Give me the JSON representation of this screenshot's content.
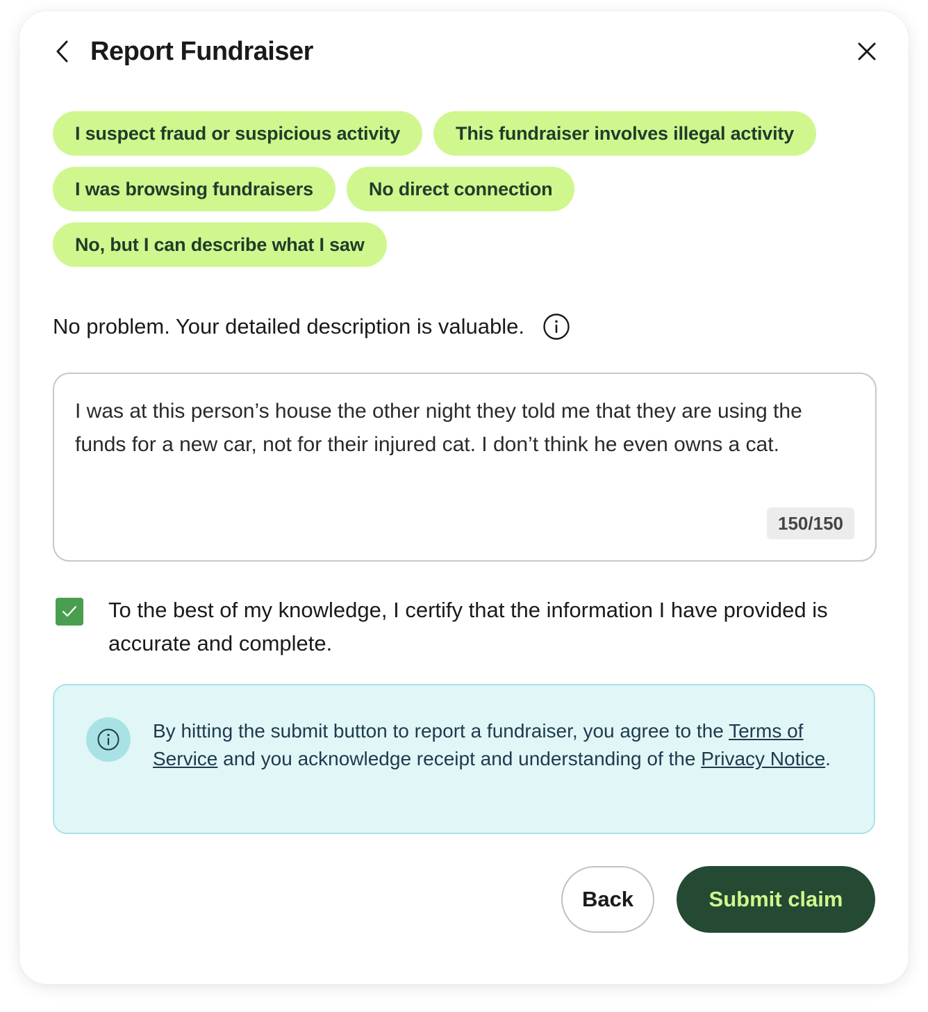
{
  "header": {
    "title": "Report Fundraiser",
    "back_icon": "chevron-left-icon",
    "close_icon": "close-icon"
  },
  "chips": [
    [
      "I suspect fraud or suspicious activity",
      "This fundraiser involves illegal activity"
    ],
    [
      "I was browsing fundraisers",
      "No direct connection"
    ],
    [
      "No, but I can describe what I saw"
    ]
  ],
  "prompt": {
    "text": "No problem. Your detailed description is valuable.",
    "icon": "info-icon"
  },
  "description": {
    "value": "I was at this person’s house the other night they told me that they are using the funds for a new car,  not for their injured cat. I don’t think he even owns a cat.",
    "counter": "150/150"
  },
  "certify": {
    "checked": true,
    "text": "To the best of my knowledge, I certify that the information I have provided is accurate and complete."
  },
  "notice": {
    "text_before": "By hitting the submit button to report a fundraiser, you agree to the ",
    "terms_link": "Terms of Service",
    "text_middle": " and you acknowledge receipt and understanding of the ",
    "privacy_link": "Privacy Notice",
    "text_after": ".",
    "icon": "info-icon"
  },
  "actions": {
    "back_label": "Back",
    "submit_label": "Submit claim"
  },
  "colors": {
    "chip_bg": "#cff78e",
    "chip_text": "#1f3d2a",
    "submit_bg": "#244a33",
    "submit_text": "#cff78e",
    "checkbox": "#4a9e4f",
    "notice_bg": "#e1f6f7",
    "notice_border": "#a8e2e6"
  }
}
